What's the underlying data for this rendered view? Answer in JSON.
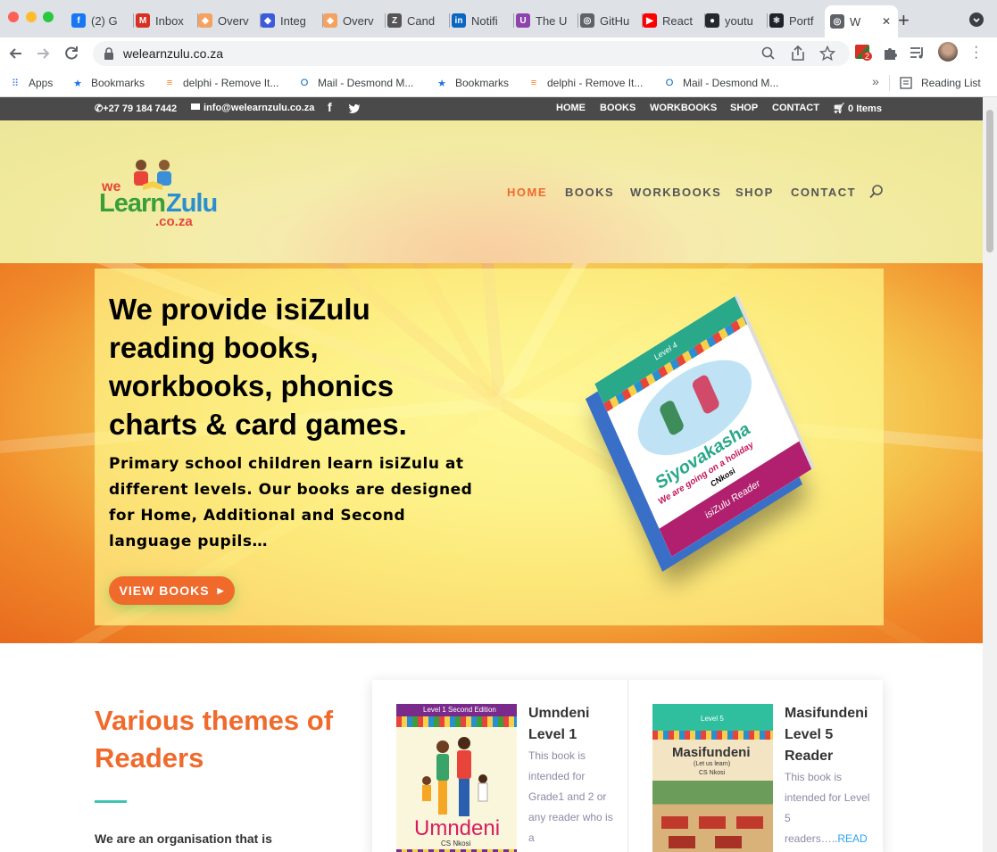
{
  "browser": {
    "tabs": [
      {
        "label": "(2) G",
        "favicon": "facebook-icon",
        "color": "#1877f2",
        "glyph": "f"
      },
      {
        "label": "Inbox",
        "favicon": "gmail-icon",
        "color": "#d93025",
        "glyph": "M"
      },
      {
        "label": "Overv",
        "favicon": "orange-app-icon",
        "color": "#f4a261",
        "glyph": "◆"
      },
      {
        "label": "Integ",
        "favicon": "blue-app-icon",
        "color": "#3b5bdb",
        "glyph": "◆"
      },
      {
        "label": "Overv",
        "favicon": "orange-app-icon",
        "color": "#f4a261",
        "glyph": "◆"
      },
      {
        "label": "Cand",
        "favicon": "zaggle-icon",
        "color": "#555555",
        "glyph": "Z"
      },
      {
        "label": "Notifi",
        "favicon": "linkedin-icon",
        "color": "#0a66c2",
        "glyph": "in"
      },
      {
        "label": "The U",
        "favicon": "purple-app-icon",
        "color": "#8e44ad",
        "glyph": "U"
      },
      {
        "label": "GitHu",
        "favicon": "globe-icon",
        "color": "#5f6368",
        "glyph": "◎"
      },
      {
        "label": "React",
        "favicon": "youtube-icon",
        "color": "#ff0000",
        "glyph": "▶"
      },
      {
        "label": "youtu",
        "favicon": "github-icon",
        "color": "#24292e",
        "glyph": "●"
      },
      {
        "label": "Portf",
        "favicon": "react-icon",
        "color": "#20232a",
        "glyph": "⚛"
      },
      {
        "label": "W",
        "favicon": "globe-icon",
        "color": "#5f6368",
        "glyph": "◎",
        "active": true
      }
    ],
    "url": "welearnzulu.co.za",
    "extension_badge": "2",
    "bookmarks": [
      {
        "label": "Apps",
        "icon": "apps-grid-icon"
      },
      {
        "label": "Bookmarks",
        "icon": "star-icon"
      },
      {
        "label": "delphi - Remove It...",
        "icon": "stackoverflow-icon"
      },
      {
        "label": "Mail - Desmond M...",
        "icon": "outlook-icon"
      },
      {
        "label": "Bookmarks",
        "icon": "star-icon"
      },
      {
        "label": "delphi - Remove It...",
        "icon": "stackoverflow-icon"
      },
      {
        "label": "Mail - Desmond M...",
        "icon": "outlook-icon"
      }
    ],
    "more_bookmarks": "»",
    "reading_list": "Reading List"
  },
  "topbar": {
    "phone": "+27 79 184 7442",
    "email": "info@welearnzulu.co.za",
    "links": [
      "HOME",
      "BOOKS",
      "WORKBOOKS",
      "SHOP",
      "CONTACT"
    ],
    "cart": "0 Items"
  },
  "header": {
    "logo": {
      "we": "we",
      "learn": "Learn",
      "zulu": "Zulu",
      "domain": ".co.za"
    },
    "nav": [
      "HOME",
      "BOOKS",
      "WORKBOOKS",
      "SHOP",
      "CONTACT"
    ],
    "active_nav": "HOME"
  },
  "hero": {
    "heading": "We provide isiZulu reading books, workbooks, phonics charts & card games.",
    "text": "Primary school children learn isiZulu at different levels. Our books are designed for Home, Additional and Second language pupils…",
    "button": "VIEW BOOKS",
    "book": {
      "level": "Level 4",
      "title": "Siyovakasha",
      "subtitle": "We are going on a holiday",
      "author": "CNkosi",
      "series": "isiZulu Reader"
    }
  },
  "section": {
    "heading": "Various themes of Readers",
    "intro": "We are an organisation that is"
  },
  "cards": [
    {
      "cover_banner": "Level 1 Second Edition",
      "cover_title": "Umndeni",
      "cover_author": "CS Nkosi",
      "title": "Umndeni Level 1",
      "desc": "This book is intended for Grade1 and 2  or any reader who is a"
    },
    {
      "cover_banner": "Level 5",
      "cover_title": "Masifundeni",
      "cover_subtitle": "(Let us learn)",
      "cover_author": "CS Nkosi",
      "title": "Masifundeni Level 5 Reader",
      "desc": "This book is intended for Level 5 readers…..",
      "more": "READ"
    }
  ],
  "colors": {
    "accent": "#f06a2c",
    "teal": "#3ec5b0",
    "topbar": "#4a4a4a",
    "link": "#2ea3f2"
  }
}
